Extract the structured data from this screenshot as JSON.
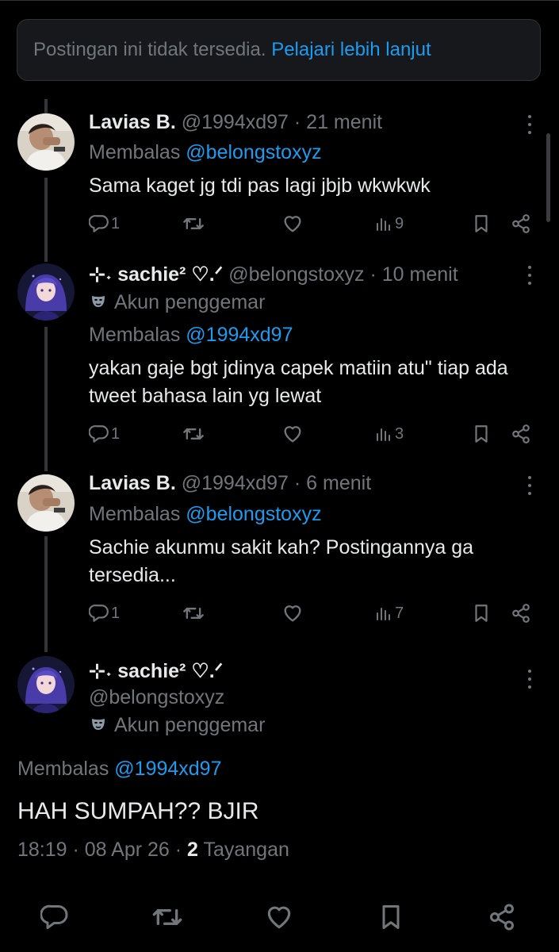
{
  "notice": {
    "text": "Postingan ini tidak tersedia.",
    "link": "Pelajari lebih lanjut"
  },
  "tweets": [
    {
      "name": "Lavias B.",
      "handle": "@1994xd97",
      "time": "· 21 menit",
      "reply_label": "Membalas",
      "reply_to": "@belongstoxyz",
      "body": "Sama kaget jg tdi pas lagi jbjb wkwkwk",
      "replies": "1",
      "views": "9"
    },
    {
      "name": "⊹˖ sachie² ♡.ᐟ",
      "handle": "@belongstoxyz",
      "time": "· 10 menit",
      "badge": "Akun penggemar",
      "reply_label": "Membalas",
      "reply_to": "@1994xd97",
      "body": "yakan gaje bgt jdinya capek matiin atu\" tiap ada tweet bahasa lain yg lewat",
      "replies": "1",
      "views": "3"
    },
    {
      "name": "Lavias B.",
      "handle": "@1994xd97",
      "time": "· 6 menit",
      "reply_label": "Membalas",
      "reply_to": "@belongstoxyz",
      "body": "Sachie akunmu sakit kah? Postingannya ga tersedia...",
      "replies": "1",
      "views": "7"
    }
  ],
  "focus": {
    "name": "⊹˖ sachie² ♡.ᐟ",
    "handle": "@belongstoxyz",
    "badge": "Akun penggemar",
    "reply_label": "Membalas",
    "reply_to": "@1994xd97",
    "body": "HAH SUMPAH?? BJIR",
    "timestamp": "18:19 · 08 Apr 26 ·",
    "views": "2",
    "views_label": "Tayangan"
  },
  "icons": {
    "reply": "reply-icon",
    "retweet": "retweet-icon",
    "like": "heart-icon",
    "views": "views-icon",
    "bookmark": "bookmark-icon",
    "share": "share-icon",
    "more": "more-icon",
    "mask": "theater-mask-icon"
  },
  "colors": {
    "background": "#000000",
    "text": "#e7e9ea",
    "muted": "#71767b",
    "link": "#1d9bf0",
    "card": "#16181c"
  }
}
